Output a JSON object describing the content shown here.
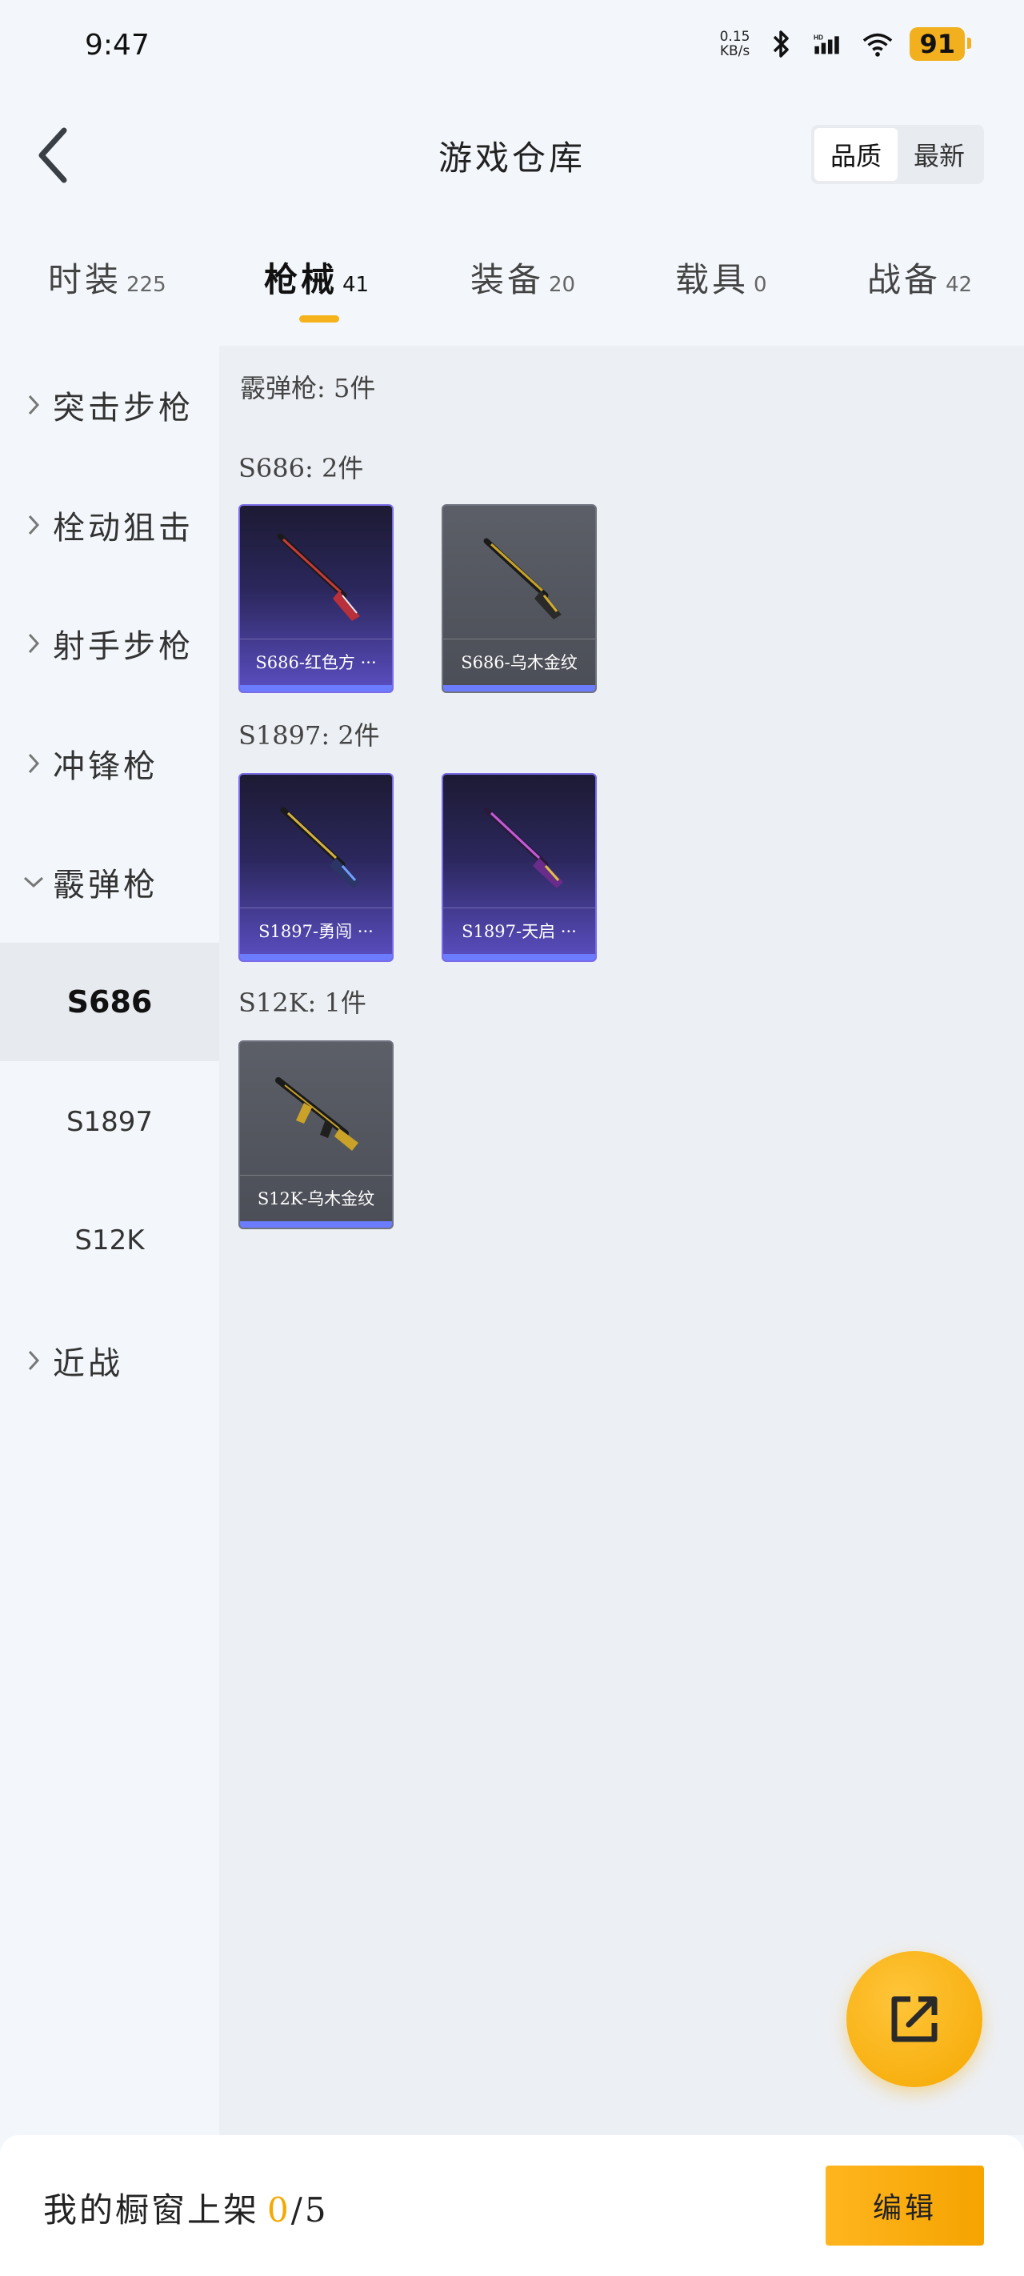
{
  "status_bar": {
    "time": "9:47",
    "net_speed_value": "0.15",
    "net_speed_unit": "KB/s",
    "battery": "91",
    "icons": [
      "bluetooth-icon",
      "hd-signal-icon",
      "wifi-icon",
      "battery-icon"
    ]
  },
  "header": {
    "title": "游戏仓库",
    "sort_options": [
      "品质",
      "最新"
    ],
    "active_sort": "品质"
  },
  "tabs": [
    {
      "label": "时装",
      "count": "225"
    },
    {
      "label": "枪械",
      "count": "41",
      "active": true
    },
    {
      "label": "装备",
      "count": "20"
    },
    {
      "label": "载具",
      "count": "0"
    },
    {
      "label": "战备",
      "count": "42"
    }
  ],
  "sidebar": {
    "categories": [
      {
        "label": "突击步枪",
        "expanded": false
      },
      {
        "label": "栓动狙击",
        "expanded": false
      },
      {
        "label": "射手步枪",
        "expanded": false
      },
      {
        "label": "冲锋枪",
        "expanded": false
      },
      {
        "label": "霰弹枪",
        "expanded": true
      },
      {
        "label": "近战",
        "expanded": false
      }
    ],
    "subitems": [
      {
        "label": "S686",
        "active": true
      },
      {
        "label": "S1897"
      },
      {
        "label": "S12K"
      }
    ]
  },
  "content": {
    "group_title": "霰弹枪: 5件",
    "subgroups": [
      {
        "title": "S686: 2件",
        "items": [
          {
            "name": "S686-红色方 ···",
            "rarity": "purple"
          },
          {
            "name": "S686-乌木金纹",
            "rarity": "gray"
          }
        ]
      },
      {
        "title": "S1897: 2件",
        "items": [
          {
            "name": "S1897-勇闯 ···",
            "rarity": "purple"
          },
          {
            "name": "S1897-天启 ···",
            "rarity": "purple"
          }
        ]
      },
      {
        "title": "S12K: 1件",
        "items": [
          {
            "name": "S12K-乌木金纹",
            "rarity": "gray"
          }
        ]
      }
    ]
  },
  "fab": {
    "icon": "share-export-icon"
  },
  "bottom_bar": {
    "label": "我的橱窗上架",
    "count": "0",
    "max": "/5",
    "edit_label": "编辑"
  },
  "colors": {
    "accent": "#f5a800",
    "tab_underline": "#f5b21a",
    "card_purple_border": "#7a6ce8",
    "card_bar": "#6c7cff"
  }
}
